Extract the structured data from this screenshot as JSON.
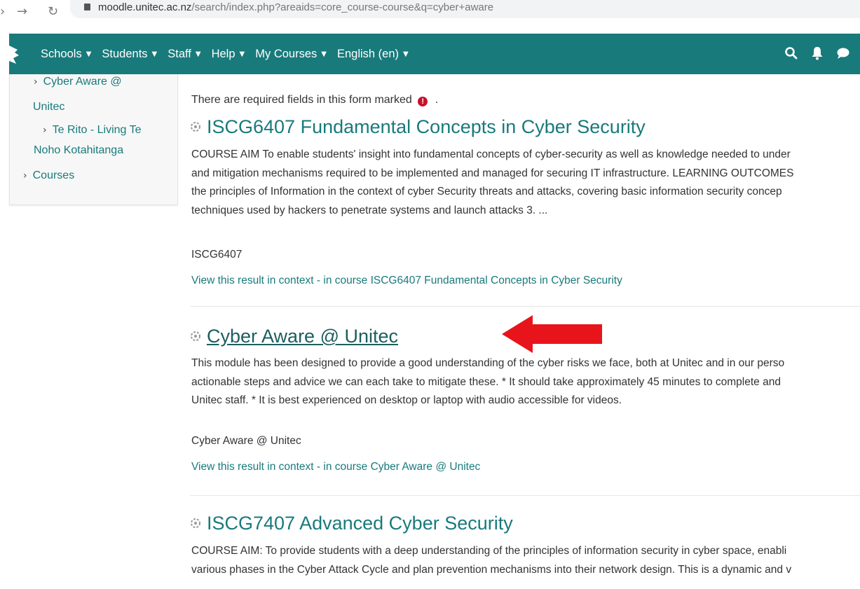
{
  "browser": {
    "url_host": "moodle.unitec.ac.nz",
    "url_path": "/search/index.php?areaids=core_course-course&q=cyber+aware"
  },
  "navbar": {
    "menu": [
      {
        "label": "Schools"
      },
      {
        "label": "Students"
      },
      {
        "label": "Staff"
      },
      {
        "label": "Help"
      },
      {
        "label": "My Courses"
      },
      {
        "label": "English (en)"
      }
    ],
    "icons": [
      "search-icon",
      "bell-icon",
      "message-icon"
    ],
    "color": "#197a7b"
  },
  "sidebar": {
    "items": [
      {
        "line1": "Cyber Aware @",
        "line2": "Unitec"
      },
      {
        "line1": "Te Rito - Living Te",
        "line2": "Noho Kotahitanga"
      },
      {
        "line1": "Courses"
      }
    ]
  },
  "notice": {
    "text": "There are required fields in this form marked",
    "icon_glyph": "!",
    "trailing": "."
  },
  "results": [
    {
      "title": "ISCG6407 Fundamental Concepts in Cyber Security",
      "summary_lines": [
        "COURSE AIM To enable students' insight into fundamental concepts of cyber-security as well as knowledge needed to under",
        "and mitigation mechanisms required to be implemented and managed for securing IT infrastructure. LEARNING OUTCOMES",
        "the principles of Information in the context of cyber Security threats and attacks, covering basic information security concep",
        "techniques used by hackers to penetrate systems and launch attacks 3. ..."
      ],
      "meta": "ISCG6407",
      "context_link": "View this result in context - in course ISCG6407 Fundamental Concepts in Cyber Security"
    },
    {
      "title": "Cyber Aware @ Unitec",
      "summary_lines": [
        "This module has been designed to provide a good understanding of the cyber risks we face, both at Unitec and in our perso",
        "actionable steps and advice we can each take to mitigate these. * It should take approximately 45 minutes to complete and",
        "Unitec staff. * It is best experienced on desktop or laptop with audio accessible for videos."
      ],
      "meta": "Cyber Aware @ Unitec",
      "context_link": "View this result in context - in course Cyber Aware @ Unitec"
    },
    {
      "title": "ISCG7407 Advanced Cyber Security",
      "summary_lines": [
        "COURSE AIM: To provide students with a deep understanding of the principles of information security in cyber space, enabli",
        "various phases in the Cyber Attack Cycle and plan prevention mechanisms into their network design. This is a dynamic and v"
      ]
    }
  ],
  "annotation": {
    "arrow_color": "#e8141b"
  }
}
